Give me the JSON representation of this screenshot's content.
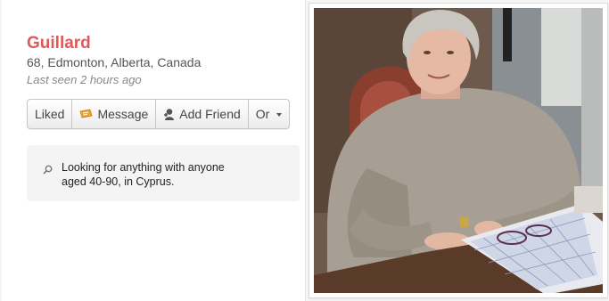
{
  "profile": {
    "name": "Guillard",
    "details": "68, Edmonton, Alberta, Canada",
    "last_seen": "Last seen 2 hours ago"
  },
  "actions": {
    "liked_label": "Liked",
    "message_label": "Message",
    "add_friend_label": "Add Friend",
    "or_label": "Or"
  },
  "looking_for": {
    "line1": "Looking for anything with anyone",
    "line2": "aged 40-90, in Cyprus."
  },
  "colors": {
    "name_accent": "#e0585b",
    "message_icon": "#f2a324"
  },
  "icons": [
    "message-icon",
    "add-friend-icon",
    "caret-down-icon",
    "search-icon"
  ]
}
